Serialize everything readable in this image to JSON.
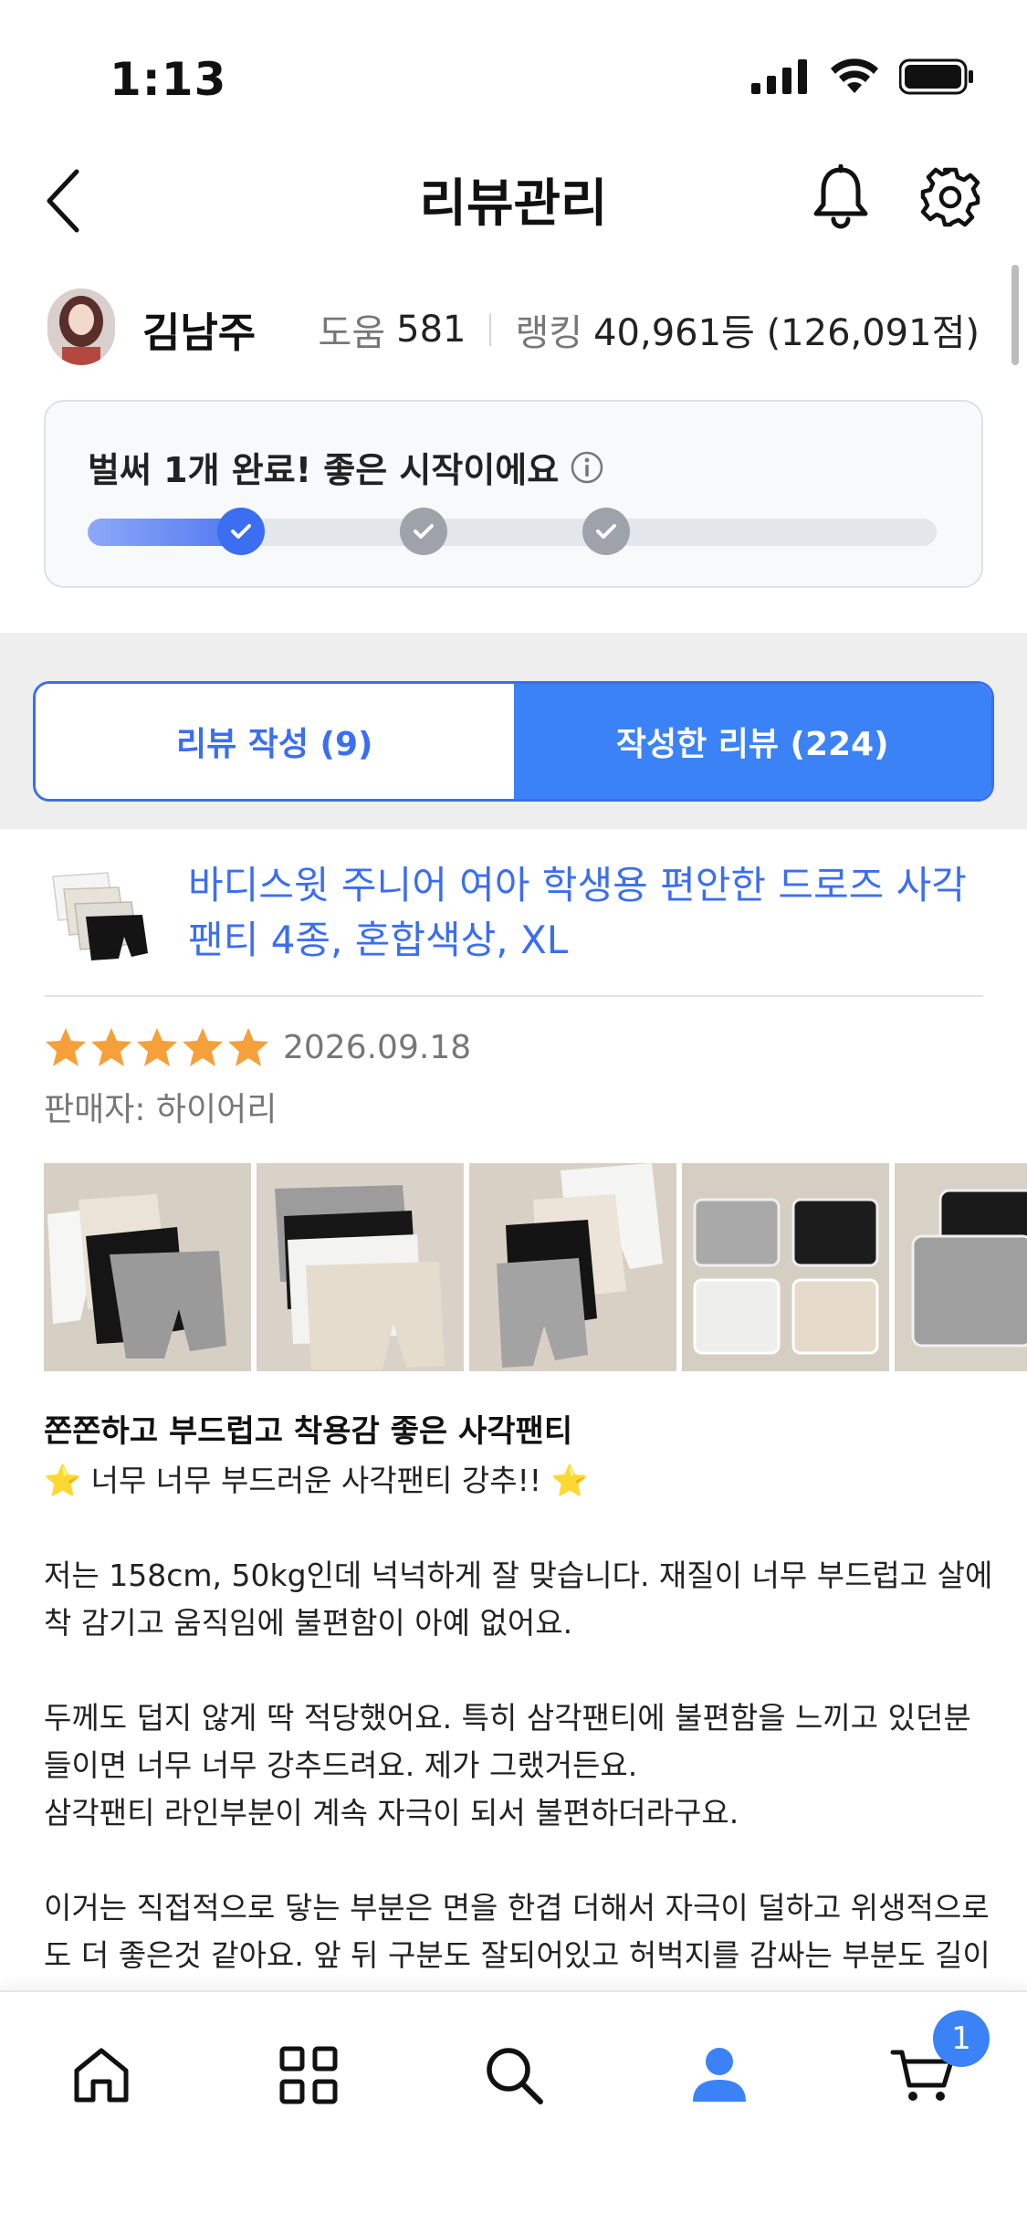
{
  "status_bar": {
    "time": "1:13"
  },
  "header": {
    "title": "리뷰관리"
  },
  "profile": {
    "name": "김남주",
    "help_label": "도움",
    "help_value": "581",
    "rank_label": "랭킹",
    "rank_value": "40,961등 (126,091점)"
  },
  "progress": {
    "title": "벌써 1개 완료! 좋은 시작이에요",
    "completed": 1,
    "total": 3
  },
  "tabs": [
    {
      "label": "리뷰 작성 (9)",
      "active": false
    },
    {
      "label": "작성한 리뷰 (224)",
      "active": true
    }
  ],
  "product": {
    "name": "바디스윗 주니어 여아 학생용 편안한 드로즈 사각팬티 4종, 혼합색상, XL"
  },
  "review": {
    "rating": 5,
    "date": "2026.09.18",
    "seller": "판매자: 하이어리",
    "headline": "쫀쫀하고 부드럽고 착용감 좋은 사각팬티",
    "body_line1": "⭐ 너무 너무 부드러운 사각팬티 강추!! ⭐",
    "body_para1": "저는 158cm, 50kg인데 넉넉하게 잘 맞습니다. 재질이 너무 부드럽고 살에 착 감기고 움직임에 불편함이 아예 없어요.",
    "body_para2a": "두께도 덥지 않게 딱 적당했어요. 특히 삼각팬티에 불편함을 느끼고 있던분들이면 너무 너무 강추드려요. 제가 그랬거든요.",
    "body_para2b": "삼각팬티 라인부분이 계속 자극이 되서 불편하더라구요.",
    "body_para3": "이거는 직접적으로 닿는 부분은 면을 한겹 더해서 자극이 덜하고 위생적으로도 더 좋은것 같아요. 앞 뒤 구분도 잘되어있고 허벅지를 감싸는 부분도 길이가 충분해서 말려올라가지 않았어요."
  },
  "bottom_nav": {
    "cart_count": "1"
  },
  "colors": {
    "accent": "#3b82f6",
    "link": "#3b6ef0",
    "star": "#f5a03a"
  }
}
